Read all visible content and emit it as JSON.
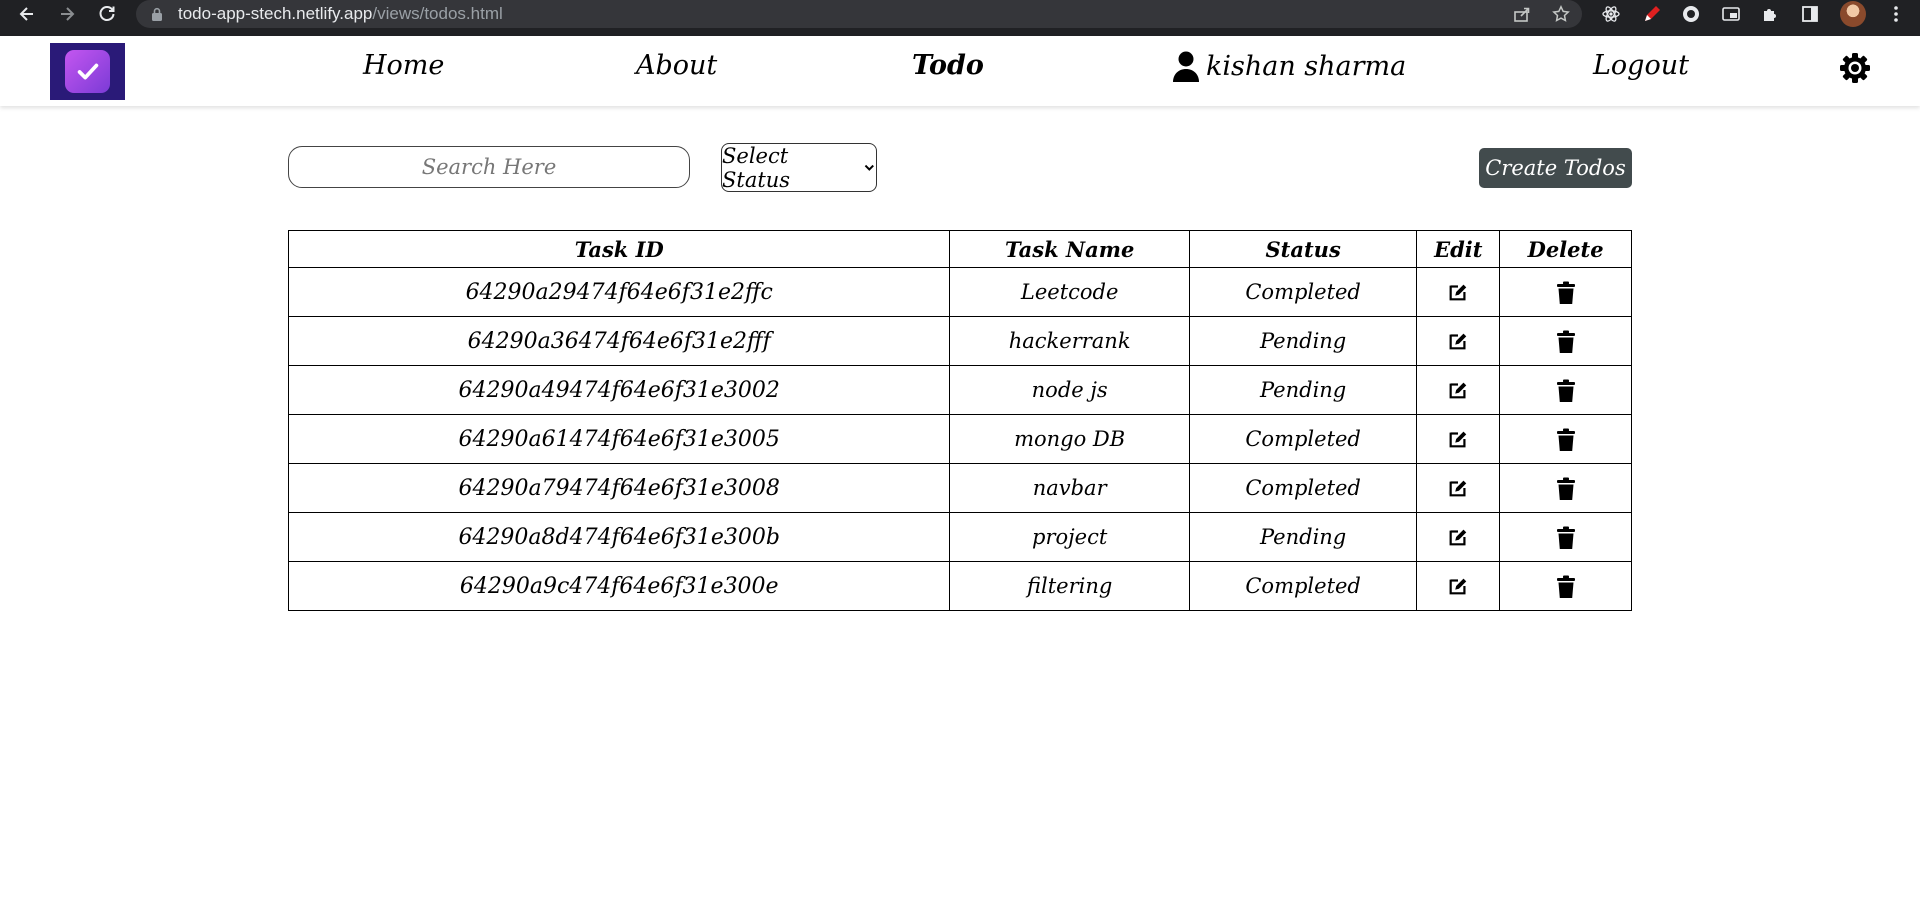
{
  "browser": {
    "url_host": "todo-app-stech.netlify.app",
    "url_path": "/views/todos.html"
  },
  "navbar": {
    "links": {
      "home": "Home",
      "about": "About",
      "todo": "Todo",
      "user": "kishan sharma",
      "logout": "Logout"
    },
    "active": "Todo"
  },
  "controls": {
    "search_placeholder": "Search Here",
    "status_select": "Select Status",
    "create_button": "Create Todos"
  },
  "table": {
    "headers": [
      "Task ID",
      "Task Name",
      "Status",
      "Edit",
      "Delete"
    ],
    "rows": [
      {
        "id": "64290a29474f64e6f31e2ffc",
        "name": "Leetcode",
        "status": "Completed"
      },
      {
        "id": "64290a36474f64e6f31e2fff",
        "name": "hackerrank",
        "status": "Pending"
      },
      {
        "id": "64290a49474f64e6f31e3002",
        "name": "node js",
        "status": "Pending"
      },
      {
        "id": "64290a61474f64e6f31e3005",
        "name": "mongo DB",
        "status": "Completed"
      },
      {
        "id": "64290a79474f64e6f31e3008",
        "name": "navbar",
        "status": "Completed"
      },
      {
        "id": "64290a8d474f64e6f31e300b",
        "name": "project",
        "status": "Pending"
      },
      {
        "id": "64290a9c474f64e6f31e300e",
        "name": "filtering",
        "status": "Completed"
      }
    ],
    "edit_icon": "edit-icon",
    "delete_icon": "trash-icon"
  },
  "colors": {
    "create_button_bg": "#424b4d",
    "logo_bg": "#2a1a78",
    "logo_accent": "#a64ae6"
  }
}
